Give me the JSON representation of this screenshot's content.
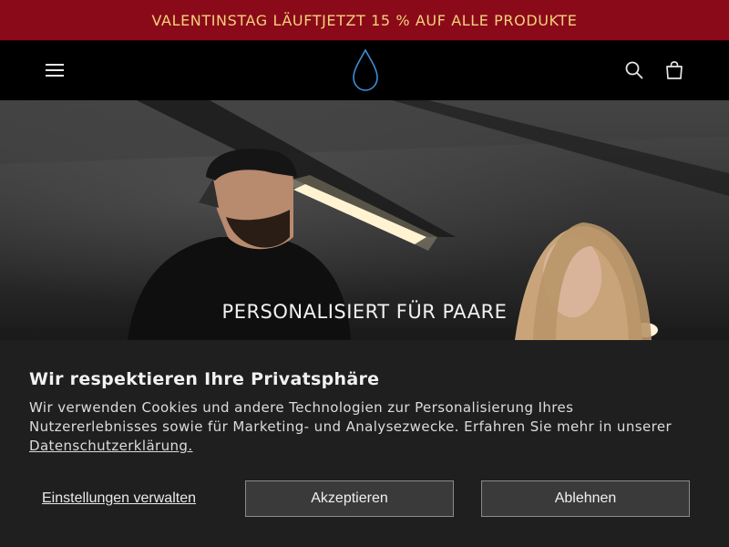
{
  "announcement": {
    "text": "VALENTINSTAG LÄUFTJETZT 15 % AUF ALLE PRODUKTE"
  },
  "header": {
    "menu_icon": "hamburger-menu-icon",
    "logo_icon": "water-drop-logo",
    "search_icon": "search-icon",
    "cart_icon": "shopping-bag-icon"
  },
  "hero": {
    "caption": "PERSONALISIERT FÜR PAARE"
  },
  "cookie_banner": {
    "title": "Wir respektieren Ihre Privatsphäre",
    "text": "Wir verwenden Cookies und andere Technologien zur Personalisierung Ihres Nutzererlebnisses sowie für Marketing- und Analysezwecke. Erfahren Sie mehr in unserer ",
    "link_text": "Datenschutzerklärung.",
    "manage_label": "Einstellungen verwalten",
    "accept_label": "Akzeptieren",
    "decline_label": "Ablehnen"
  },
  "colors": {
    "announcement_bg": "#8b0a1a",
    "announcement_text": "#f2d27a",
    "header_bg": "#000000",
    "logo_stroke": "#3a8fd6",
    "banner_bg": "#1f1f1f",
    "button_bg": "#3a3a3a"
  }
}
